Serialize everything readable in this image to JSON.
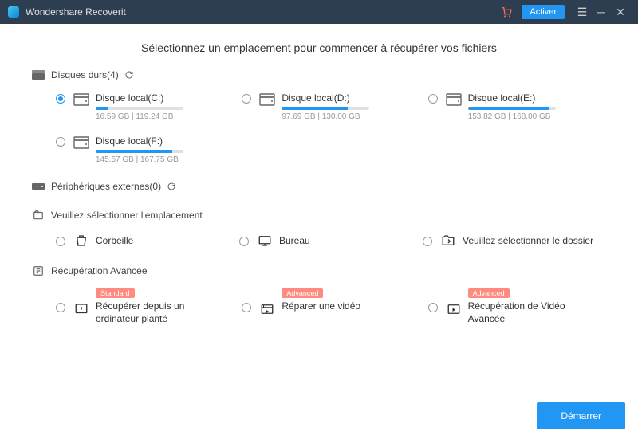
{
  "titlebar": {
    "app_name": "Wondershare Recoverit",
    "activate_label": "Activer"
  },
  "heading": "Sélectionnez un emplacement pour commencer à récupérer vos fichiers",
  "sections": {
    "disks": {
      "title": "Disques durs(4)",
      "items": [
        {
          "name": "Disque local(C:)",
          "used": "16.59 GB",
          "total": "119.24 GB",
          "fill_pct": 14,
          "selected": true
        },
        {
          "name": "Disque local(D:)",
          "used": "97.69 GB",
          "total": "130.00 GB",
          "fill_pct": 75,
          "selected": false
        },
        {
          "name": "Disque local(E:)",
          "used": "153.82 GB",
          "total": "168.00 GB",
          "fill_pct": 92,
          "selected": false
        },
        {
          "name": "Disque local(F:)",
          "used": "145.57 GB",
          "total": "167.75 GB",
          "fill_pct": 87,
          "selected": false
        }
      ]
    },
    "external": {
      "title": "Périphériques externes(0)"
    },
    "location": {
      "title": "Veuillez sélectionner l'emplacement",
      "items": [
        "Corbeille",
        "Bureau",
        "Veuillez sélectionner le dossier"
      ]
    },
    "advanced": {
      "title": "Récupération Avancée",
      "items": [
        {
          "badge": "Standard",
          "label": "Récupérer depuis un ordinateur planté"
        },
        {
          "badge": "Advanced",
          "label": "Réparer une vidéo"
        },
        {
          "badge": "Advanced",
          "label": "Récupération de Vidéo Avancée"
        }
      ]
    }
  },
  "footer": {
    "start_label": "Démarrer"
  }
}
